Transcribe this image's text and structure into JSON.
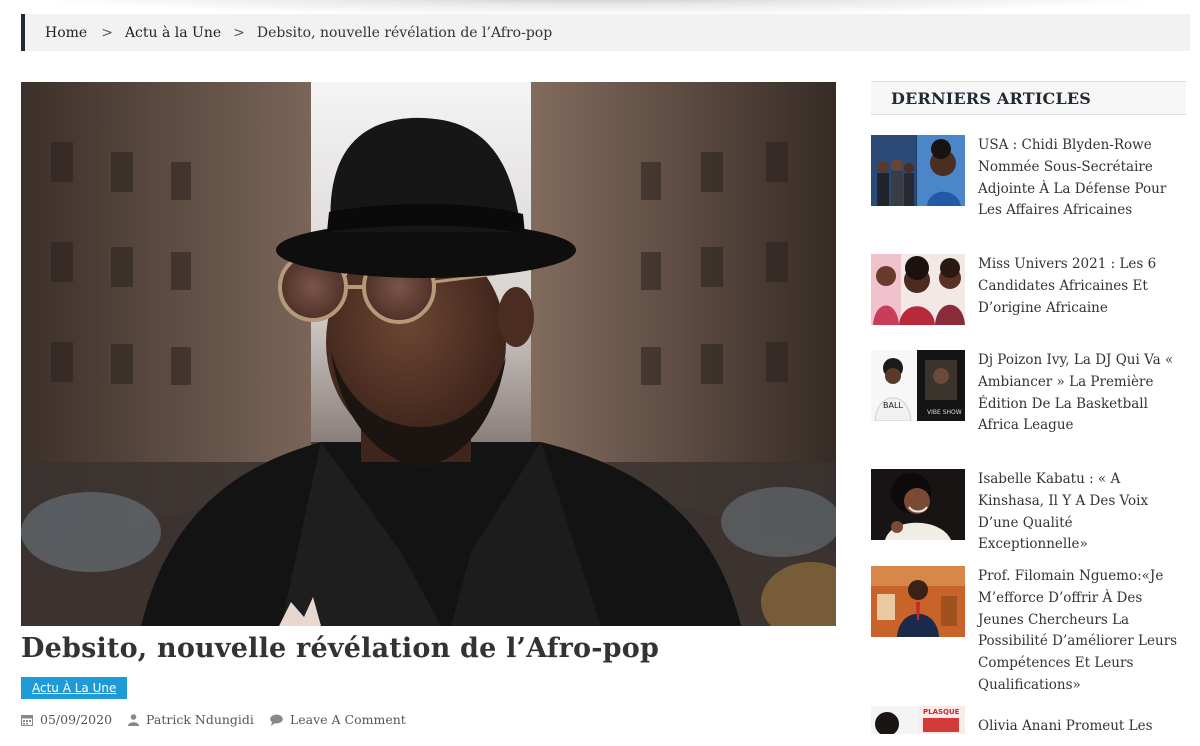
{
  "breadcrumb": {
    "home": "Home",
    "separator": ">",
    "category": "Actu à la Une",
    "current": "Debsito, nouvelle révélation de l’Afro-pop"
  },
  "article": {
    "title": "Debsito, nouvelle révélation de l’Afro-pop",
    "category_badge": "Actu À La Une",
    "date": "05/09/2020",
    "author": "Patrick Ndungidi",
    "comment_link": "Leave A Comment"
  },
  "sidebar": {
    "heading": "DERNIERS ARTICLES",
    "posts": [
      {
        "title": "USA : Chidi Blyden-Rowe Nommée Sous-Secrétaire Adjointe À La Défense Pour Les Affaires Africaines"
      },
      {
        "title": "Miss Univers 2021 : Les 6 Candidates Africaines Et D’origine Africaine"
      },
      {
        "title": "Dj Poizon Ivy, La DJ Qui Va « Ambiancer » La Première Édition De La Basketball Africa League"
      },
      {
        "title": "Isabelle Kabatu : « A Kinshasa, Il Y A Des Voix D’une Qualité Exceptionnelle»"
      },
      {
        "title": "Prof. Filomain Nguemo:«Je M’efforce D’offrir À Des Jeunes Chercheurs La Possibilité D’améliorer Leurs Compétences Et Leurs Qualifications»"
      },
      {
        "title": "Olivia Anani Promeut Les"
      }
    ]
  },
  "colors": {
    "accent": "#1e9bd7",
    "heading_dark": "#1f2a35",
    "breadcrumb_bg": "#f2f2f2"
  },
  "icons": [
    "calendar-icon",
    "user-icon",
    "comment-icon"
  ]
}
